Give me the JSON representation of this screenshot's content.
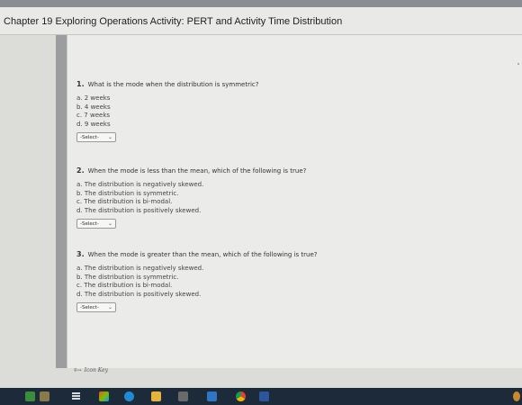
{
  "page": {
    "title": "Chapter 19 Exploring Operations Activity: PERT and Activity Time Distribution"
  },
  "questions": [
    {
      "number": "1.",
      "text": "What is the mode when the distribution is symmetric?",
      "choices": [
        "a. 2 weeks",
        "b. 4 weeks",
        "c. 7 weeks",
        "d. 9 weeks"
      ],
      "select_value": "-Select-"
    },
    {
      "number": "2.",
      "text": "When the mode is less than the mean, which of the following is true?",
      "choices": [
        "a. The distribution is negatively skewed.",
        "b. The distribution is symmetric.",
        "c. The distribution is bi-modal.",
        "d. The distribution is positively skewed."
      ],
      "select_value": "-Select-"
    },
    {
      "number": "3.",
      "text": "When the mode is greater than the mean, which of the following is true?",
      "choices": [
        "a. The distribution is negatively skewed.",
        "b. The distribution is symmetric.",
        "c. The distribution is bi-modal.",
        "d. The distribution is positively skewed."
      ],
      "select_value": "-Select-"
    }
  ],
  "footer": {
    "icon_key_label": "Icon Key"
  },
  "taskbar": {
    "icons": [
      "start-icon",
      "widgets-icon",
      "task-view-icon",
      "store-icon",
      "edge-icon",
      "file-explorer-icon",
      "calculator-icon",
      "mail-icon",
      "chrome-icon",
      "word-icon"
    ]
  }
}
